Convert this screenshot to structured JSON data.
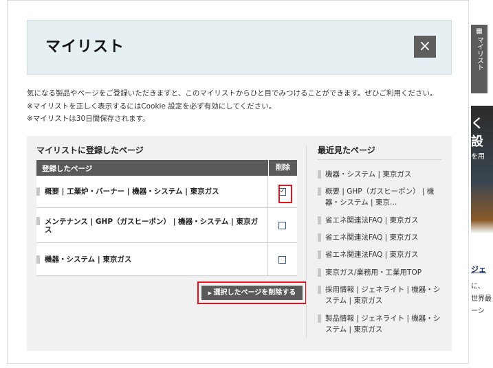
{
  "modal": {
    "title": "マイリスト",
    "close_icon": "×",
    "notes": [
      "気になる製品やページをご登録いただきますと、このマイリストからひと目でみつけることができます。ぜひご利用ください。",
      "※マイリストを正しく表示するにはCookie 設定を必ず有効にしてください。",
      "※マイリストは30日間保存されます。"
    ]
  },
  "registered": {
    "title": "マイリストに登録したページ",
    "col_page": "登録したページ",
    "col_delete": "削除",
    "rows": [
      {
        "text": "概要 | 工業炉・バーナー | 機器・システム | 東京ガス",
        "checked": true,
        "mark": "✓"
      },
      {
        "text": "メンテナンス | GHP（ガスヒーポン） | 機器・システム | 東京ガス",
        "checked": false,
        "mark": ""
      },
      {
        "text": "機器・システム | 東京ガス",
        "checked": false,
        "mark": ""
      }
    ],
    "delete_button": "選択したページを削除する"
  },
  "recent": {
    "title": "最近見たページ",
    "items": [
      "機器・システム | 東京ガス",
      "概要 | GHP（ガスヒーポン） | 機器・システム | 東京…",
      "省エネ関連法FAQ | 東京ガス",
      "省エネ関連法FAQ | 東京ガス",
      "省エネ関連法FAQ | 東京ガス",
      "東京ガス/業務用・工業用TOP",
      "採用情報 | ジェネライト | 機器・システム | 東京ガス",
      "製品情報 | ジェネライト | 機器・システム | 東京ガス"
    ]
  },
  "side": {
    "tab_icon": "▦",
    "tab_label": "マイリスト",
    "hero_big": "く設",
    "hero_small": "を用",
    "link_text": "ジェ",
    "text_lines": [
      "に、",
      "世界最",
      "ーシ"
    ]
  },
  "colors": {
    "header_bg": "#e6eff2",
    "panel_bg": "#f1f1f1",
    "dark": "#5a5a5a",
    "highlight": "#e8121c"
  }
}
